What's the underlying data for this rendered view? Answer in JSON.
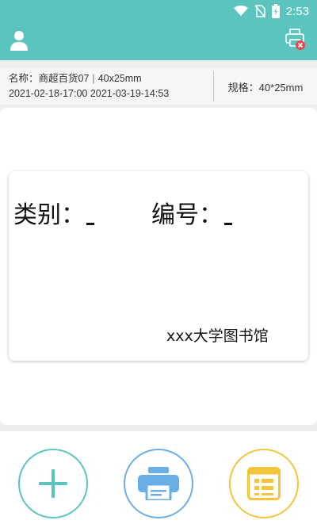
{
  "status_bar": {
    "time": "2:53"
  },
  "info": {
    "name_label": "名称：",
    "name_value": "商超百货07",
    "size": "40x25mm",
    "date_range": "2021-02-18-17:00 2021-03-19-14:53",
    "spec": "规格：40*25mm"
  },
  "label": {
    "category": "类别：",
    "number": "编号：",
    "library": "xxx大学图书馆"
  },
  "colors": {
    "primary": "#5cc4bf",
    "print_blue": "#6aaee8",
    "list_yellow": "#f3c43c",
    "alert_red": "#e8474a"
  },
  "icons": [
    "user-icon",
    "printer-disconnected-icon",
    "plus-icon",
    "printer-icon",
    "list-icon",
    "wifi-icon",
    "no-sim-icon",
    "battery-icon"
  ]
}
